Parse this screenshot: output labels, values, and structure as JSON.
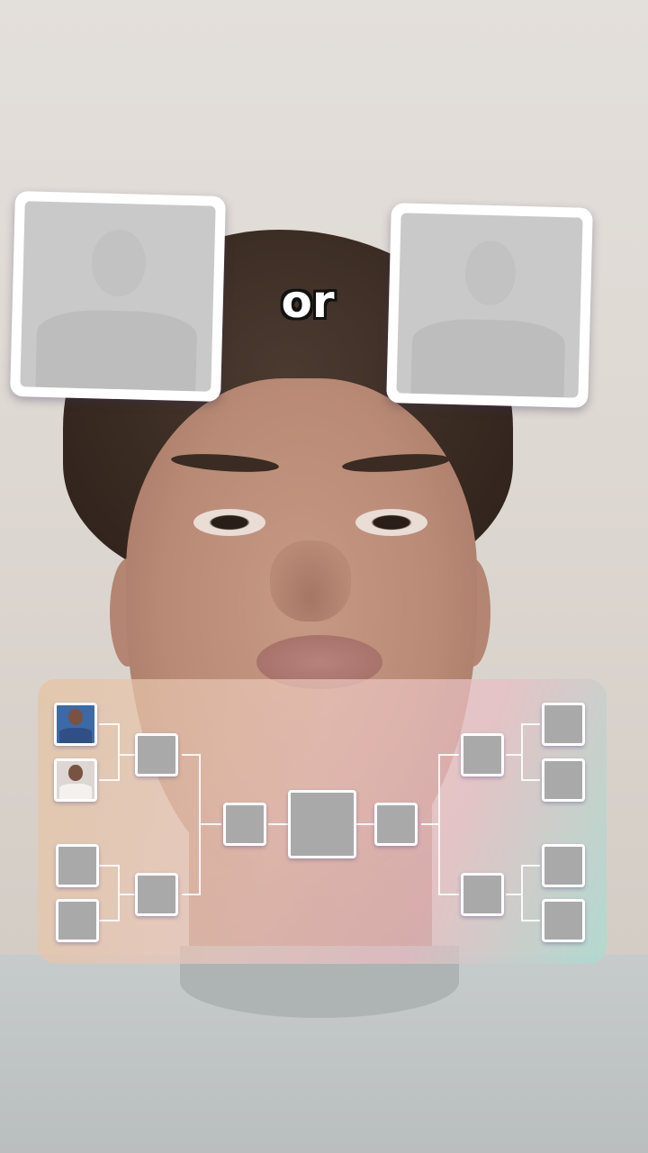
{
  "filter": {
    "separator_text": "or",
    "left_choice": {
      "icon": "player-photo-germany-kit"
    },
    "right_choice": {
      "icon": "player-photo-white-kit"
    }
  },
  "bracket": {
    "slots": [
      {
        "id": "l-r1-1",
        "filled": true,
        "icon": "player-photo-germany-kit"
      },
      {
        "id": "l-r1-2",
        "filled": true,
        "icon": "player-photo-white-kit"
      },
      {
        "id": "l-r1-3",
        "filled": false
      },
      {
        "id": "l-r1-4",
        "filled": false
      },
      {
        "id": "l-r2-1",
        "filled": false
      },
      {
        "id": "l-r2-2",
        "filled": false
      },
      {
        "id": "l-semi",
        "filled": false
      },
      {
        "id": "final",
        "filled": false
      },
      {
        "id": "r-semi",
        "filled": false
      },
      {
        "id": "r-r2-1",
        "filled": false
      },
      {
        "id": "r-r2-2",
        "filled": false
      },
      {
        "id": "r-r1-1",
        "filled": false
      },
      {
        "id": "r-r1-2",
        "filled": false
      },
      {
        "id": "r-r1-3",
        "filled": false
      },
      {
        "id": "r-r1-4",
        "filled": false
      }
    ]
  },
  "colors": {
    "card_border": "#ffffff",
    "empty_slot": "#a9a9a9",
    "or_text": "#ffffff",
    "or_outline": "#111111"
  }
}
